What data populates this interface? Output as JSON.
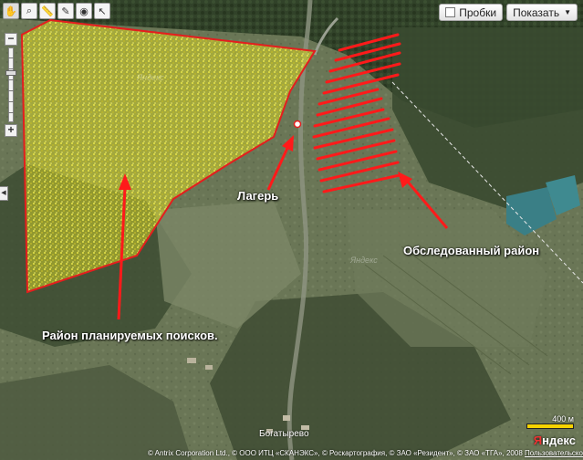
{
  "toolbar": {
    "tools": [
      "hand-tool",
      "magnifier-tool",
      "ruler-tool",
      "edit-tool",
      "layers-tool",
      "pointer-tool"
    ]
  },
  "controls": {
    "traffic_label": "Пробки",
    "show_label": "Показать"
  },
  "zoom": {
    "plus": "+",
    "minus": "−"
  },
  "labels": {
    "search_area": "Район планируемых поисков.",
    "camp": "Лагерь",
    "surveyed_area": "Обследованный район"
  },
  "places": {
    "village": "Богатырево"
  },
  "watermarks": [
    "Яндекс",
    "Яндекс"
  ],
  "scale": {
    "label": "400 м"
  },
  "logo": {
    "first": "Я",
    "rest": "ндекс"
  },
  "copyright": {
    "text": "© Antrix Corporation Ltd., © ООО ИТЦ «СКАНЭКС», © Роскартография, © ЗАО «Резидент», © ЗАО «ТГА», 2008",
    "link": "Пользовательское соглашение"
  },
  "colors": {
    "annotation": "#ff1a1a",
    "highlight": "#d4d43a",
    "water": "#3a7f86"
  }
}
